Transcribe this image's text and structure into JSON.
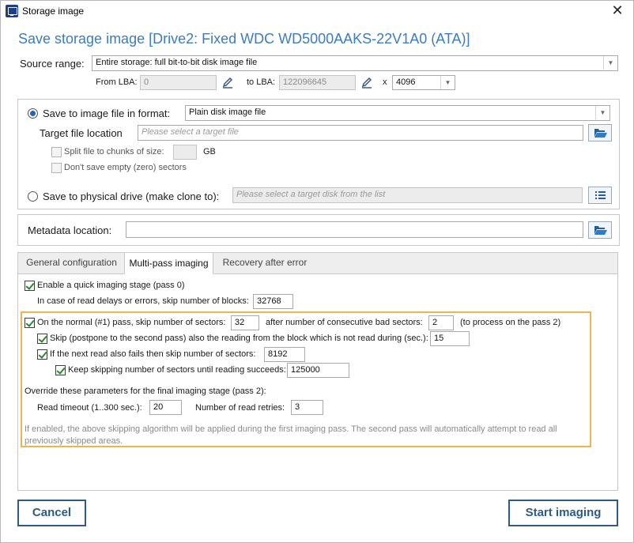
{
  "window": {
    "title": "Storage image",
    "close_glyph": "✕"
  },
  "heading": "Save storage image [Drive2: Fixed WDC WD5000AAKS-22V1A0 (ATA)]",
  "source_range": {
    "label": "Source range:",
    "value": "Entire storage: full bit-to-bit disk image file",
    "from_lba_label": "From LBA:",
    "from_lba_value": "0",
    "to_lba_label": "to LBA:",
    "to_lba_value": "122096645",
    "multiplier_label": "x",
    "block_value": "4096"
  },
  "save_to_file": {
    "label": "Save to image file in format:",
    "format_value": "Plain disk image file",
    "target_label": "Target file location",
    "target_placeholder": "Please select a target file",
    "split_label": "Split file to chunks of size:",
    "split_value": "",
    "split_unit": "GB",
    "dont_save_empty_label": "Don't save empty (zero) sectors"
  },
  "save_to_drive": {
    "label": "Save to physical drive (make clone to):",
    "placeholder": "Please select a target disk from the list"
  },
  "metadata": {
    "label": "Metadata location:",
    "value": ""
  },
  "tabs": [
    {
      "label": "General configuration"
    },
    {
      "label": "Multi-pass imaging"
    },
    {
      "label": "Recovery after error"
    }
  ],
  "multipass": {
    "quick_stage_label": "Enable a quick imaging stage (pass 0)",
    "quick_skip_label": "In case of read delays or errors, skip number of blocks:",
    "quick_skip_value": "32768",
    "normal_pass_label": "On the normal (#1) pass, skip number of sectors:",
    "normal_pass_value": "32",
    "after_bad_label": "after number of consecutive bad sectors:",
    "after_bad_value": "2",
    "after_bad_suffix": "(to process on the pass 2)",
    "postpone_label": "Skip (postpone to the second pass) also the reading from the block which is not read during (sec.):",
    "postpone_value": "15",
    "next_read_label": "If the next read also fails then skip number of sectors:",
    "next_read_value": "8192",
    "keep_skipping_label": "Keep skipping number of sectors until reading succeeds:",
    "keep_skipping_value": "125000",
    "override_label": "Override these parameters for the final imaging stage (pass 2):",
    "read_timeout_label": "Read timeout (1..300 sec.):",
    "read_timeout_value": "20",
    "read_retries_label": "Number of read retries:",
    "read_retries_value": "3",
    "note": "If enabled, the above skipping algorithm will be applied during the first imaging pass. The second pass will automatically attempt to read all previously skipped areas."
  },
  "buttons": {
    "cancel": "Cancel",
    "start": "Start imaging"
  },
  "colors": {
    "heading": "#3c7cbf",
    "accent_border": "#e8b64f",
    "button_border": "#2e5b86"
  }
}
